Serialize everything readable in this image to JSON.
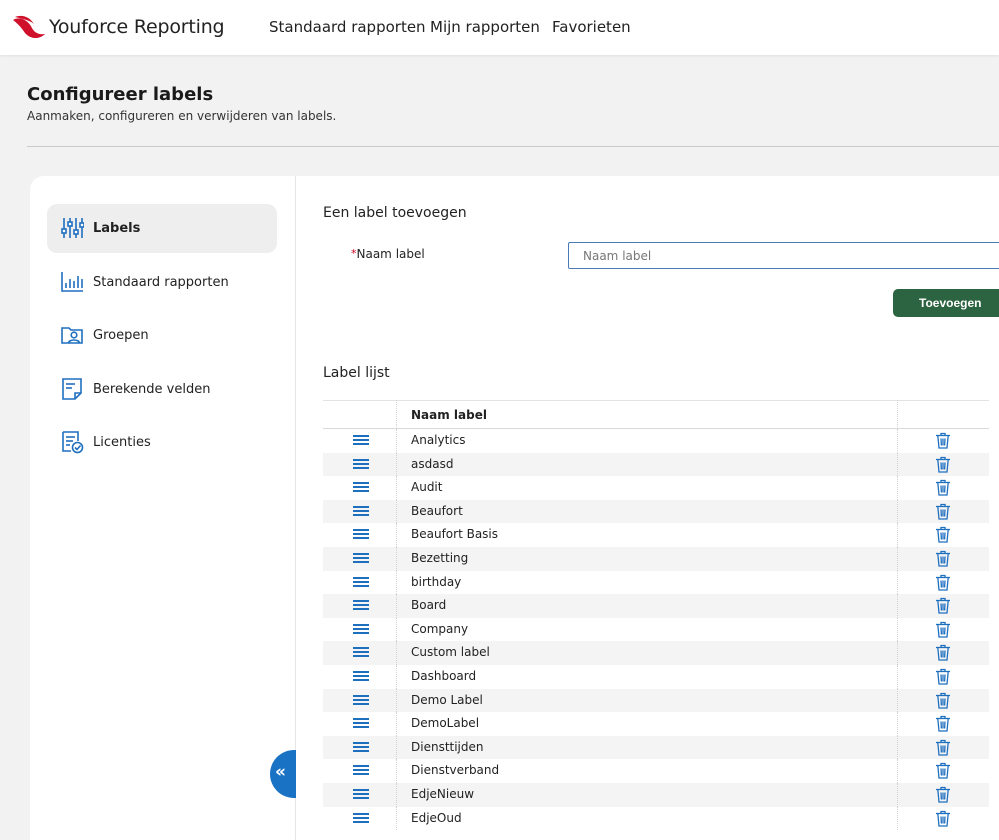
{
  "app": {
    "brand": "Youforce Reporting"
  },
  "nav": [
    {
      "label": "Standaard rapporten"
    },
    {
      "label": "Mijn rapporten"
    },
    {
      "label": "Favorieten"
    }
  ],
  "page": {
    "title": "Configureer labels",
    "subtitle": "Aanmaken, configureren en verwijderen van labels."
  },
  "sidebar": {
    "items": [
      {
        "label": "Labels",
        "icon": "sliders-icon",
        "active": true
      },
      {
        "label": "Standaard rapporten",
        "icon": "bar-chart-icon",
        "active": false
      },
      {
        "label": "Groepen",
        "icon": "group-folder-icon",
        "active": false
      },
      {
        "label": "Berekende velden",
        "icon": "calculated-field-icon",
        "active": false
      },
      {
        "label": "Licenties",
        "icon": "license-check-icon",
        "active": false
      }
    ]
  },
  "form": {
    "title": "Een label toevoegen",
    "required_mark": "*",
    "field_label": "Naam label",
    "input_placeholder": "Naam label",
    "input_value": "",
    "add_button": "Toevoegen"
  },
  "list": {
    "title": "Label lijst",
    "column_header": "Naam label",
    "rows": [
      "Analytics",
      "asdasd",
      "Audit",
      "Beaufort",
      "Beaufort Basis",
      "Bezetting",
      "birthday",
      "Board",
      "Company",
      "Custom label",
      "Dashboard",
      "Demo Label",
      "DemoLabel",
      "Diensttijden",
      "Dienstverband",
      "EdjeNieuw",
      "EdjeOud"
    ]
  },
  "colors": {
    "accent_blue": "#1f6fbf",
    "add_button_green": "#2c6340",
    "brand_red": "#d0112b"
  }
}
